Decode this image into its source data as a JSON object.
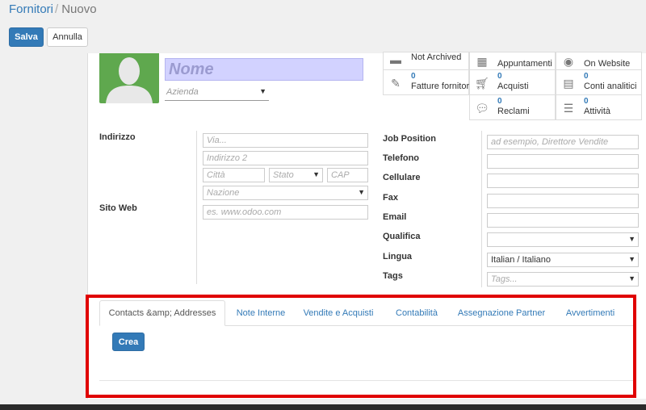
{
  "breadcrumb": {
    "parent": "Fornitori",
    "separator": "/",
    "current": "Nuovo"
  },
  "toolbar": {
    "save_label": "Salva",
    "discard_label": "Annulla"
  },
  "form": {
    "name_placeholder": "Nome",
    "company_placeholder": "Azienda",
    "stat_buttons": [
      {
        "number": "",
        "label": "Not Archived",
        "icon": "archive-icon"
      },
      {
        "number": "",
        "label": "Appuntamenti",
        "icon": "calendar-icon"
      },
      {
        "number": "",
        "label": "On Website",
        "icon": "globe-icon"
      },
      {
        "number": "0",
        "label": "Fatture fornitori",
        "icon": "pencil-square-icon"
      },
      {
        "number": "0",
        "label": "Acquisti",
        "icon": "shopping-cart-icon"
      },
      {
        "number": "0",
        "label": "Conti analitici",
        "icon": "book-icon"
      },
      {
        "number": "0",
        "label": "Reclami",
        "icon": "comments-icon"
      },
      {
        "number": "0",
        "label": "Attività",
        "icon": "tasks-icon"
      }
    ],
    "address_label": "Indirizzo",
    "street_placeholder": "Via...",
    "street2_placeholder": "Indirizzo 2",
    "city_placeholder": "Città",
    "state_placeholder": "Stato",
    "zip_placeholder": "CAP",
    "country_placeholder": "Nazione",
    "website_label": "Sito Web",
    "website_placeholder": "es. www.odoo.com",
    "job_position_label": "Job Position",
    "job_position_placeholder": "ad esempio, Direttore Vendite",
    "phone_label": "Telefono",
    "mobile_label": "Cellulare",
    "fax_label": "Fax",
    "email_label": "Email",
    "title_label": "Qualifica",
    "language_label": "Lingua",
    "language_value": "Italian / Italiano",
    "tags_label": "Tags",
    "tags_placeholder": "Tags..."
  },
  "notebook": {
    "tabs": [
      "Contacts &amp; Addresses",
      "Note Interne",
      "Vendite e Acquisti",
      "Contabilità",
      "Assegnazione Partner",
      "Avvertimenti"
    ],
    "create_label": "Crea"
  },
  "colors": {
    "primary": "#337ab7",
    "highlight": "#e00000",
    "avatar_bg": "#5fa84e"
  }
}
